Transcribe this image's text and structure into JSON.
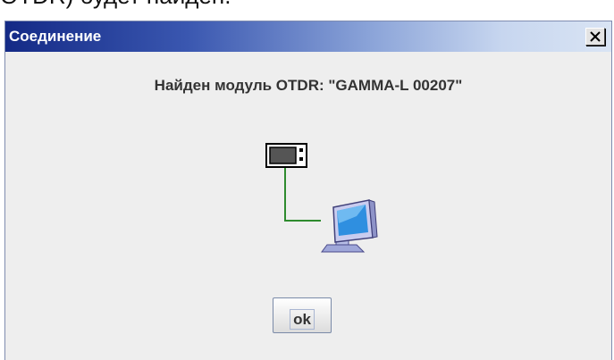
{
  "background_text": "OTDR) будет найден.",
  "dialog": {
    "title": "Соединение",
    "message": "Найден модуль OTDR:  \"GAMMA-L 00207\"",
    "ok_label": "ok"
  },
  "icons": {
    "close": "close-icon",
    "device": "otdr-device-icon",
    "computer": "computer-monitor-icon"
  },
  "colors": {
    "title_bar_start": "#142a86",
    "title_bar_end": "#d9e4f4",
    "connector_line": "#2e8b2e",
    "dialog_background": "#eeeeee"
  }
}
